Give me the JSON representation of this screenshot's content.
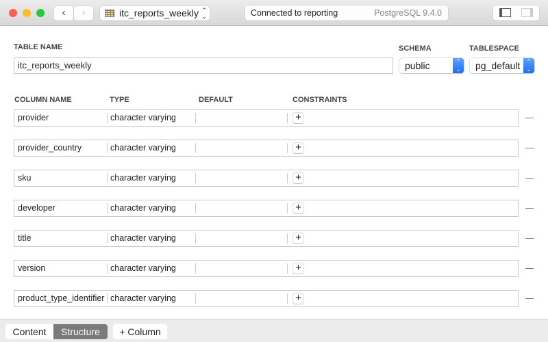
{
  "window": {
    "table_selector": "itc_reports_weekly",
    "connection_status": "Connected to reporting",
    "server_version": "PostgreSQL 9.4.0"
  },
  "form": {
    "table_name_label": "TABLE NAME",
    "table_name": "itc_reports_weekly",
    "schema_label": "SCHEMA",
    "schema": "public",
    "tablespace_label": "TABLESPACE",
    "tablespace": "pg_default"
  },
  "columns_header": {
    "name": "COLUMN NAME",
    "type": "TYPE",
    "default": "DEFAULT",
    "constraints": "CONSTRAINTS"
  },
  "columns": [
    {
      "name": "provider",
      "type": "character varying",
      "default": ""
    },
    {
      "name": "provider_country",
      "type": "character varying",
      "default": ""
    },
    {
      "name": "sku",
      "type": "character varying",
      "default": ""
    },
    {
      "name": "developer",
      "type": "character varying",
      "default": ""
    },
    {
      "name": "title",
      "type": "character varying",
      "default": ""
    },
    {
      "name": "version",
      "type": "character varying",
      "default": ""
    },
    {
      "name": "product_type_identifier",
      "type": "character varying",
      "default": ""
    }
  ],
  "bottom": {
    "content_tab": "Content",
    "structure_tab": "Structure",
    "add_column": "+ Column"
  },
  "colors": {
    "accent": "#2f7cf6",
    "selected_tab": "#7a7a7a"
  }
}
